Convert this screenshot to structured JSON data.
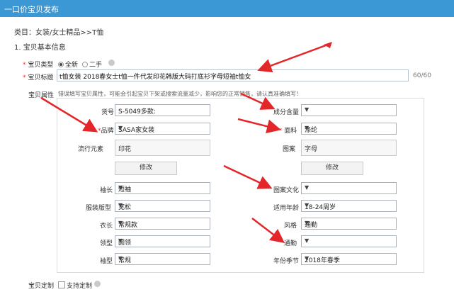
{
  "header": {
    "title": "一口价宝贝发布"
  },
  "category": {
    "text": "类目：女装/女士精品>>T恤"
  },
  "section": {
    "title": "1. 宝贝基本信息"
  },
  "item_type": {
    "label": "宝贝类型",
    "options": [
      "全新",
      "二手"
    ],
    "selected": "全新"
  },
  "item_title": {
    "label": "宝贝标题",
    "value": "t恤女装 2018春女士t恤一件代发印花韩版大码打底衫字母短袖t恤女",
    "counter": "60/60"
  },
  "attributes": {
    "label": "宝贝属性",
    "hint": "错误填写宝贝属性，可能会引起宝贝下架或搜索流量减少，影响您的正常销售，请认真准确填写！",
    "fields": [
      {
        "label": "货号",
        "value": "S-5049多款:",
        "kind": "text"
      },
      {
        "label": "成分含量",
        "value": "",
        "kind": "select"
      },
      {
        "label": "品牌",
        "value": "SASA家女装",
        "kind": "select"
      },
      {
        "label": "面料",
        "value": "涤纶",
        "kind": "select"
      },
      {
        "label": "流行元素",
        "value": "印花",
        "kind": "tags"
      },
      {
        "label": "图案",
        "value": "字母",
        "kind": "tags"
      },
      {
        "label": "袖长",
        "value": "短袖",
        "kind": "select"
      },
      {
        "label": "图案文化",
        "value": "",
        "kind": "select"
      },
      {
        "label": "服装版型",
        "value": "宽松",
        "kind": "select"
      },
      {
        "label": "适用年龄",
        "value": "18-24周岁",
        "kind": "select"
      },
      {
        "label": "衣长",
        "value": "常规款",
        "kind": "select"
      },
      {
        "label": "风格",
        "value": "通勤",
        "kind": "select"
      },
      {
        "label": "领型",
        "value": "圆领",
        "kind": "select"
      },
      {
        "label": "通勤",
        "value": "",
        "kind": "select"
      },
      {
        "label": "袖型",
        "value": "常规",
        "kind": "select"
      },
      {
        "label": "年份季节",
        "value": "2018年春季",
        "kind": "select"
      }
    ],
    "edit_label": "修改"
  },
  "customization": {
    "label": "宝贝定制",
    "checkbox_label": "支持定制"
  },
  "colors": {
    "header_bg": "#3c97d5",
    "arrow": "#e3262a",
    "required": "#e4393c"
  },
  "icons": {
    "help": "question-circle-icon",
    "dropdown": "chevron-down-icon"
  }
}
